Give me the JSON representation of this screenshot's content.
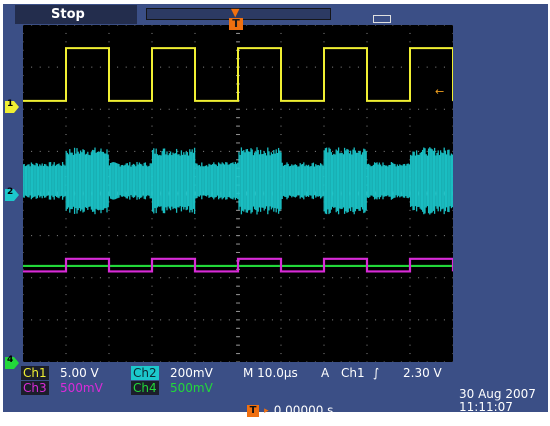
{
  "status": {
    "run_state": "Stop"
  },
  "trigger": {
    "marker_label": "T",
    "level_arrow": "←"
  },
  "markers": {
    "ch1": "1",
    "ch2": "2",
    "ch4": "4"
  },
  "readout": {
    "ch1_label": "Ch1",
    "ch1_scale": "5.00 V",
    "ch2_label": "Ch2",
    "ch2_scale": "200mV",
    "ch3_label": "Ch3",
    "ch3_scale": "500mV",
    "ch4_label": "Ch4",
    "ch4_scale": "500mV",
    "horizontal": "M 10.0μs",
    "trigger_mode": "A",
    "trigger_source": "Ch1",
    "trigger_slope": "∫",
    "trigger_level": "2.30 V",
    "trigger_position": "0.00000 s",
    "date": "30 Aug 2007",
    "time": "11:11:07"
  },
  "colors": {
    "ch1": "#f0ef32",
    "ch2": "#1cc8cc",
    "ch3": "#d92bd8",
    "ch4": "#22d83a",
    "frame": "#3b4f86",
    "trigger": "#f07010"
  },
  "waveforms": {
    "period_us": 20,
    "duty": 0.5,
    "ch1": {
      "high_div": 3.45,
      "low_div": 2.2
    },
    "ch2": {
      "burst_div": 0.8,
      "quiet_div": 0.45
    },
    "ch3": {
      "high_div": -1.55,
      "low_div": -1.85
    },
    "ch4": {
      "level_div": -1.72
    }
  }
}
